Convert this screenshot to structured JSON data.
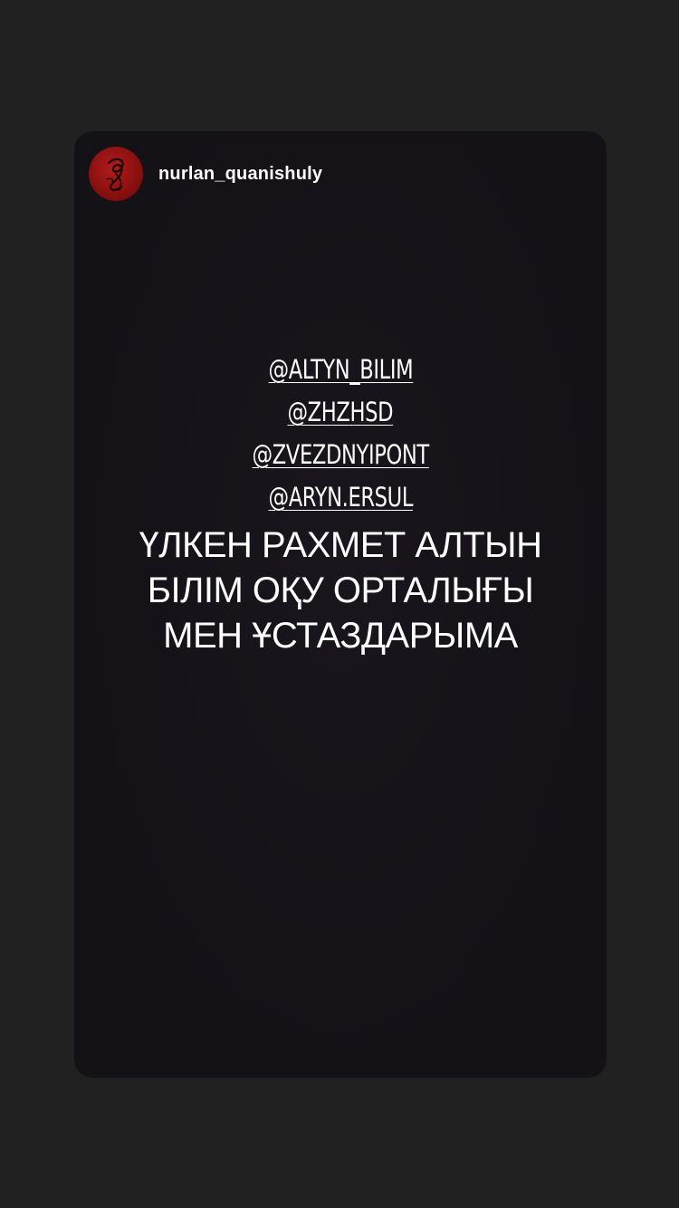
{
  "story": {
    "username": "nurlan_quanishuly",
    "avatar_icon": "calligraphy-logo-icon",
    "mentions": [
      "@ALTYN_BILIM",
      "@ZHZHSD",
      "@ZVEZDNYIPONT",
      "@ARYN.ERSUL"
    ],
    "caption_lines": [
      "ҮЛКЕН РАХМЕТ АЛТЫН",
      "БІЛІМ ОҚУ ОРТАЛЫҒЫ",
      "МЕН ҰСТАЗДАРЫМА"
    ]
  },
  "colors": {
    "page_background": "#212121",
    "card_background": "#141117",
    "avatar_red": "#8c1010",
    "text": "#ffffff"
  }
}
